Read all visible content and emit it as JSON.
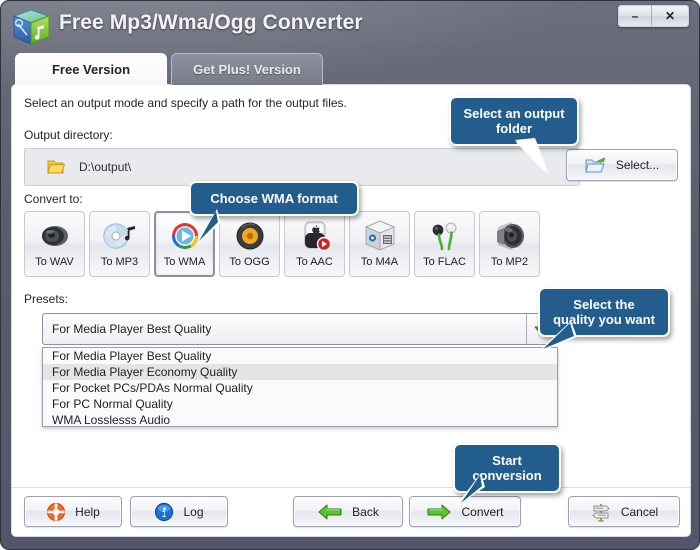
{
  "window": {
    "title": "Free Mp3/Wma/Ogg Converter",
    "app_icon": "music-cube-icon",
    "minimize_label": "–",
    "close_label": "✕"
  },
  "tabs": [
    {
      "label": "Free Version",
      "active": true
    },
    {
      "label": "Get Plus! Version",
      "active": false
    }
  ],
  "main": {
    "instruction": "Select an output mode and specify a path for the output files.",
    "output_directory_label": "Output directory:",
    "output_directory_value": "D:\\output\\",
    "select_button_label": "Select...",
    "convert_to_label": "Convert to:",
    "presets_label": "Presets:"
  },
  "formats": [
    {
      "label": "To WAV",
      "icon": "wav-speaker-icon",
      "selected": false
    },
    {
      "label": "To MP3",
      "icon": "mp3-cd-note-icon",
      "selected": false
    },
    {
      "label": "To WMA",
      "icon": "wma-play-icon",
      "selected": true
    },
    {
      "label": "To OGG",
      "icon": "ogg-disc-icon",
      "selected": false
    },
    {
      "label": "To AAC",
      "icon": "aac-ipod-icon",
      "selected": false
    },
    {
      "label": "To M4A",
      "icon": "m4a-box-icon",
      "selected": false
    },
    {
      "label": "To FLAC",
      "icon": "flac-earbuds-icon",
      "selected": false
    },
    {
      "label": "To MP2",
      "icon": "mp2-speaker-icon",
      "selected": false
    }
  ],
  "presets": {
    "selected": "For Media Player Best Quality",
    "dropdown_arrow_icon": "green-down-arrow-icon",
    "options": [
      {
        "label": "For Media Player Best Quality",
        "highlighted": false
      },
      {
        "label": "For Media Player Economy Quality",
        "highlighted": true
      },
      {
        "label": "For Pocket PCs/PDAs Normal Quality",
        "highlighted": false
      },
      {
        "label": "For PC Normal Quality",
        "highlighted": false
      },
      {
        "label": "WMA Losslesss Audio",
        "highlighted": false
      }
    ]
  },
  "footer": {
    "help_label": "Help",
    "log_label": "Log",
    "back_label": "Back",
    "convert_label": "Convert",
    "cancel_label": "Cancel"
  },
  "callouts": {
    "output_folder": "Select an output\nfolder",
    "wma_format": "Choose WMA format",
    "quality": "Select the\nquality you want",
    "start_conversion": "Start\nconversion"
  },
  "colors": {
    "callout_blue": "#225d8e",
    "accent_green": "#4caf2f",
    "titlebar_gray": "#5a5d6b"
  }
}
